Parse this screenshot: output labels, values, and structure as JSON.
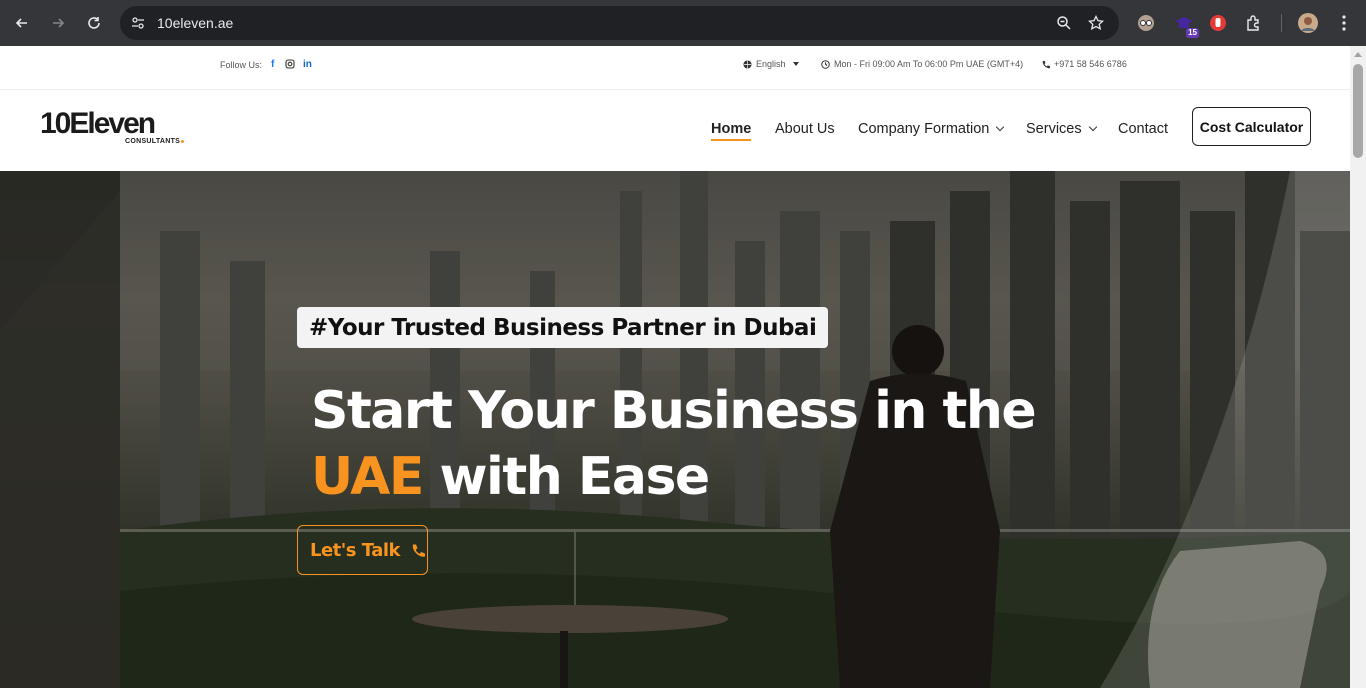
{
  "browser": {
    "url": "10eleven.ae",
    "extension_badge": "15"
  },
  "topbar": {
    "follow_label": "Follow Us:",
    "social": [
      "f",
      "linkedin"
    ],
    "language": "English",
    "hours": "Mon - Fri 09:00 Am To 06:00 Pm UAE (GMT+4)",
    "phone": "+971 58 546 6786"
  },
  "header": {
    "logo_text": "10Eleven",
    "logo_sub": "CONSULTANTS",
    "nav": {
      "home": "Home",
      "about": "About Us",
      "company": "Company Formation",
      "services": "Services",
      "contact": "Contact"
    },
    "cost_button": "Cost Calculator"
  },
  "hero": {
    "tagline": "#Your Trusted Business Partner in Dubai",
    "headline_line1": "Start Your Business in the",
    "headline_highlight": "UAE",
    "headline_rest": " with Ease",
    "cta": "Let's Talk"
  },
  "colors": {
    "accent": "#f7931e",
    "chrome_bg": "#35363a",
    "omnibox_bg": "#202124"
  }
}
